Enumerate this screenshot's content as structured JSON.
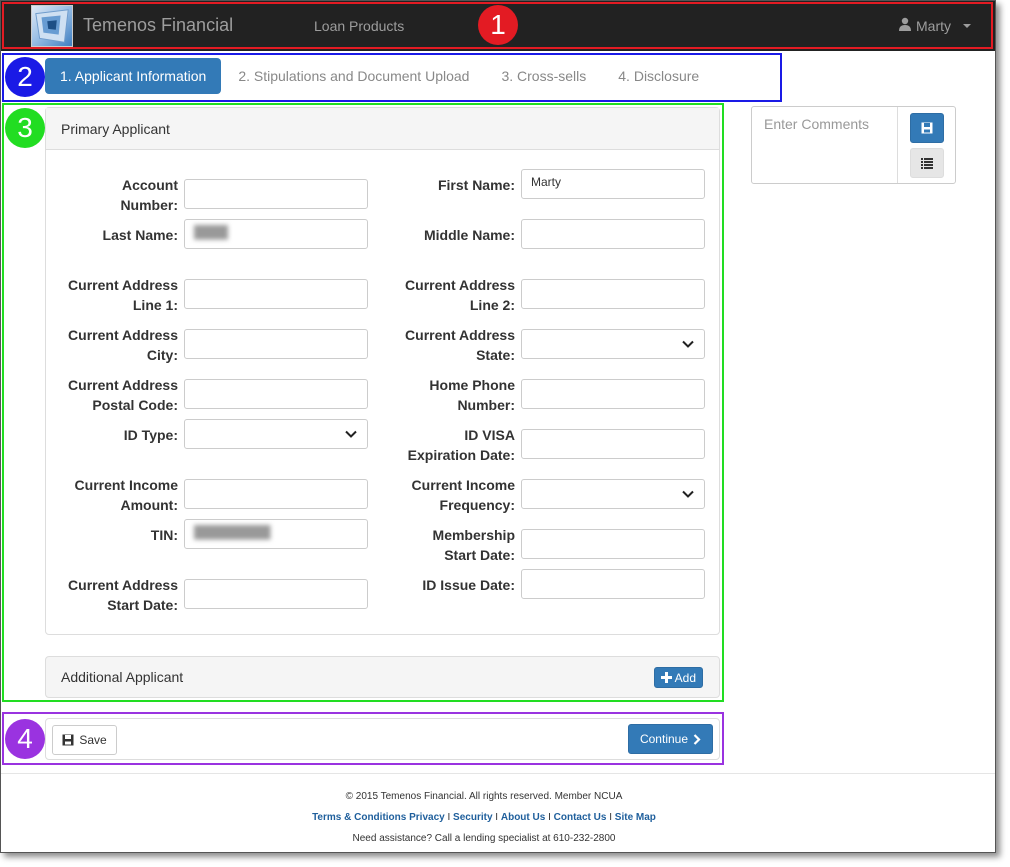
{
  "navbar": {
    "brand": "Temenos Financial",
    "nav_link": "Loan Products",
    "user_name": "Marty"
  },
  "annotations": {
    "navbar_marker": "1",
    "steps_marker": "2",
    "form_marker": "3",
    "actions_marker": "4",
    "colors": {
      "navbar": "#e31b23",
      "steps": "#1a1ae6",
      "form": "#22dd22",
      "actions": "#9a33e0"
    }
  },
  "steps": [
    {
      "label": "1. Applicant Information",
      "active": true
    },
    {
      "label": "2. Stipulations and Document Upload",
      "active": false
    },
    {
      "label": "3. Cross-sells",
      "active": false
    },
    {
      "label": "4. Disclosure",
      "active": false
    }
  ],
  "primary_panel": {
    "title": "Primary Applicant",
    "left_fields": [
      {
        "label_lines": [
          "Account",
          "Number:"
        ],
        "value": "",
        "type": "text"
      },
      {
        "label_lines": [
          "Last Name:"
        ],
        "value": "",
        "type": "text",
        "blurred": true
      },
      {
        "label_lines": [
          "Current Address",
          "Line 1:"
        ],
        "value": "",
        "type": "text"
      },
      {
        "label_lines": [
          "Current Address",
          "City:"
        ],
        "value": "",
        "type": "text"
      },
      {
        "label_lines": [
          "Current Address",
          "Postal Code:"
        ],
        "value": "",
        "type": "text"
      },
      {
        "label_lines": [
          "ID Type:"
        ],
        "value": "",
        "type": "select"
      },
      {
        "label_lines": [
          "Current Income",
          "Amount:"
        ],
        "value": "",
        "type": "text"
      },
      {
        "label_lines": [
          "TIN:"
        ],
        "value": "",
        "type": "text",
        "blurred": true
      },
      {
        "label_lines": [
          "Current Address",
          "Start Date:"
        ],
        "value": "",
        "type": "text"
      }
    ],
    "right_fields": [
      {
        "label_lines": [
          "First Name:"
        ],
        "value": "Marty",
        "type": "text"
      },
      {
        "label_lines": [
          "Middle Name:"
        ],
        "value": "",
        "type": "text"
      },
      {
        "label_lines": [
          "Current Address",
          "Line 2:"
        ],
        "value": "",
        "type": "text"
      },
      {
        "label_lines": [
          "Current Address",
          "State:"
        ],
        "value": "",
        "type": "select"
      },
      {
        "label_lines": [
          "Home Phone",
          "Number:"
        ],
        "value": "",
        "type": "text"
      },
      {
        "label_lines": [
          "ID VISA",
          "Expiration Date:"
        ],
        "value": "",
        "type": "text"
      },
      {
        "label_lines": [
          "Current Income",
          "Frequency:"
        ],
        "value": "",
        "type": "select"
      },
      {
        "label_lines": [
          "Membership",
          "Start Date:"
        ],
        "value": "",
        "type": "text"
      },
      {
        "label_lines": [
          "ID Issue Date:"
        ],
        "value": "",
        "type": "text"
      }
    ]
  },
  "additional_panel": {
    "title": "Additional Applicant",
    "add_label": "Add"
  },
  "actions": {
    "save_label": "Save",
    "continue_label": "Continue"
  },
  "comments": {
    "placeholder": "Enter Comments",
    "save_icon": "floppy-disk-icon",
    "list_icon": "list-icon"
  },
  "footer": {
    "copyright": "© 2015 Temenos Financial. All rights reserved.  Member NCUA",
    "links": [
      "Terms & Conditions",
      "Privacy",
      "Security",
      "About Us",
      "Contact Us",
      "Site Map"
    ],
    "assist": "Need assistance? Call a lending specialist at 610-232-2800"
  },
  "colors": {
    "navbar_bg": "#222222",
    "primary": "#337ab7",
    "footer_link": "#1f5f9c"
  }
}
